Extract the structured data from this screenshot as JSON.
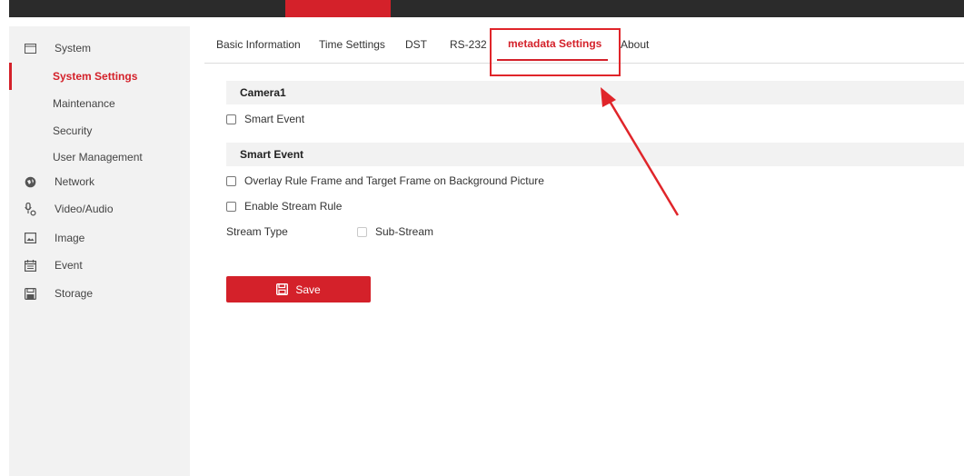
{
  "sidebar": {
    "items": [
      {
        "label": "System",
        "icon": "system-icon"
      },
      {
        "label": "System Settings",
        "active": true
      },
      {
        "label": "Maintenance"
      },
      {
        "label": "Security"
      },
      {
        "label": "User Management"
      },
      {
        "label": "Network",
        "icon": "network-icon"
      },
      {
        "label": "Video/Audio",
        "icon": "video-audio-icon"
      },
      {
        "label": "Image",
        "icon": "image-icon"
      },
      {
        "label": "Event",
        "icon": "event-icon"
      },
      {
        "label": "Storage",
        "icon": "storage-icon"
      }
    ]
  },
  "tabs": [
    {
      "label": "Basic Information"
    },
    {
      "label": "Time Settings"
    },
    {
      "label": "DST"
    },
    {
      "label": "RS-232"
    },
    {
      "label": "metadata Settings",
      "active": true
    },
    {
      "label": "About"
    }
  ],
  "content": {
    "camera_section": "Camera1",
    "smart_event_checkbox": "Smart Event",
    "smart_event_section": "Smart Event",
    "overlay_checkbox": "Overlay Rule Frame and Target Frame on Background Picture",
    "stream_rule_checkbox": "Enable Stream Rule",
    "stream_type_label": "Stream Type",
    "sub_stream_label": "Sub-Stream",
    "save_label": "Save"
  },
  "colors": {
    "accent": "#d4212a",
    "topbar": "#2b2b2b",
    "sidebar_bg": "#f2f2f2",
    "annotation": "#e0252a"
  }
}
